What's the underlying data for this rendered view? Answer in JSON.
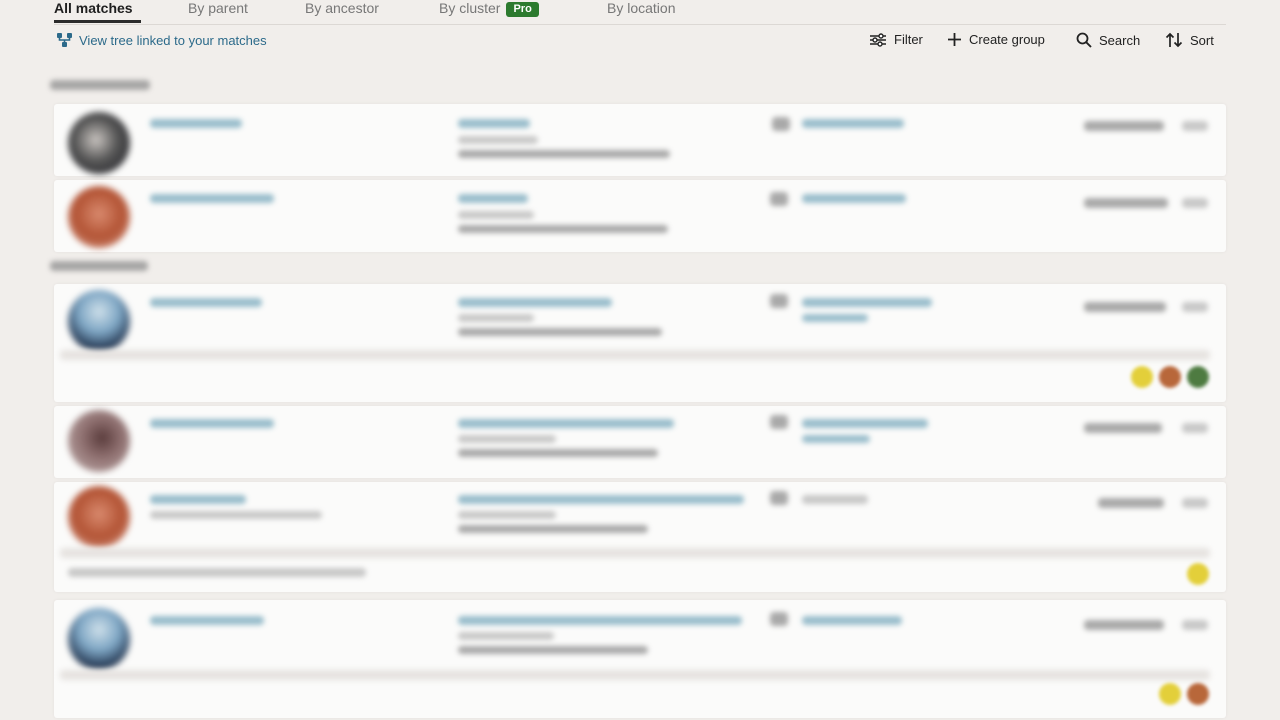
{
  "tabs": [
    {
      "label": "All matches",
      "active": true
    },
    {
      "label": "By parent"
    },
    {
      "label": "By ancestor"
    },
    {
      "label": "By cluster",
      "badge": "Pro"
    },
    {
      "label": "By location"
    }
  ],
  "toolbar": {
    "tree_link": "View tree linked to your matches",
    "filter": "Filter",
    "create_group": "Create group",
    "search": "Search",
    "sort": "Sort"
  },
  "colors": {
    "accent_link": "#2c6a8a",
    "pro_badge": "#2c7a2e",
    "background": "#f1eeeb"
  },
  "icons": [
    "tree-icon",
    "filter-sliders-icon",
    "plus-icon",
    "search-icon",
    "sort-arrows-icon"
  ]
}
